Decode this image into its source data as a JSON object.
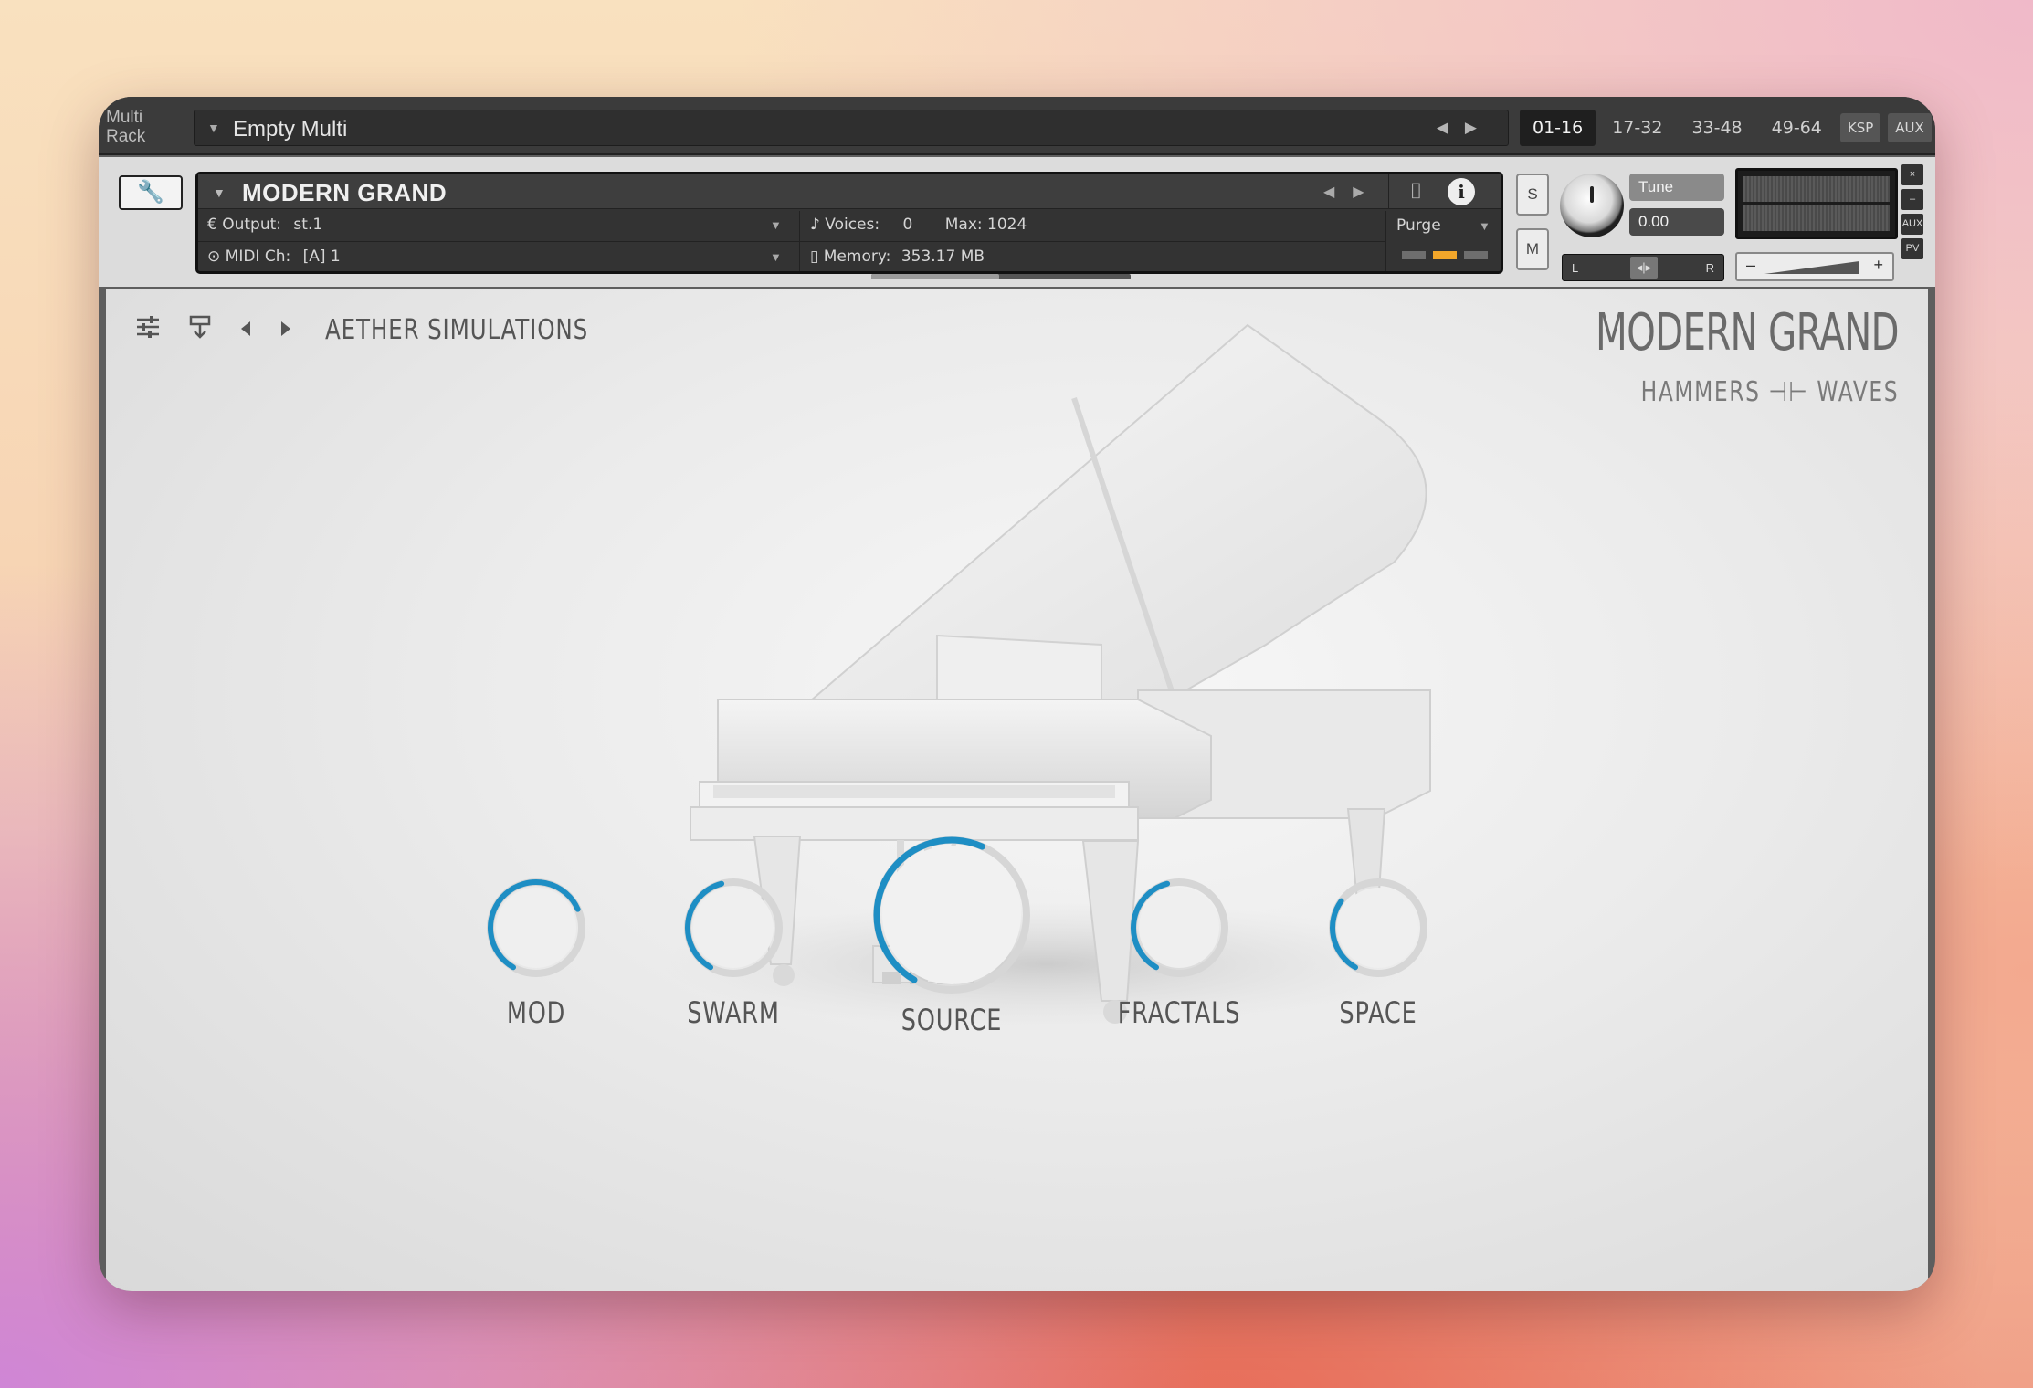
{
  "multi_rack": {
    "label_line1": "Multi",
    "label_line2": "Rack",
    "name": "Empty Multi",
    "tabs": [
      {
        "label": "01-16",
        "active": true
      },
      {
        "label": "17-32",
        "active": false
      },
      {
        "label": "33-48",
        "active": false
      },
      {
        "label": "49-64",
        "active": false
      }
    ],
    "ksp_label": "KSP",
    "aux_label": "AUX"
  },
  "instrument": {
    "title": "MODERN GRAND",
    "output_label": "Output:",
    "output_value": "st.1",
    "midi_label": "MIDI Ch:",
    "midi_value": "[A]  1",
    "voices_label": "Voices:",
    "voices_value": "0",
    "max_label": "Max:",
    "max_value": "1024",
    "memory_label": "Memory:",
    "memory_value": "353.17 MB",
    "purge_label": "Purge",
    "solo_label": "S",
    "mute_label": "M",
    "tune_label": "Tune",
    "tune_value": "0.00",
    "pan_left": "L",
    "pan_right": "R",
    "side_buttons": [
      "×",
      "–",
      "AUX",
      "PV"
    ]
  },
  "panel": {
    "brand": "AETHER SIMULATIONS",
    "logo_title": "MODERN GRAND",
    "logo_subtitle": "HAMMERS ⊣⊢ WAVES",
    "knobs": [
      {
        "label": "MOD",
        "value": 0.72
      },
      {
        "label": "SWARM",
        "value": 0.45
      },
      {
        "label": "SOURCE",
        "value": 0.58
      },
      {
        "label": "FRACTALS",
        "value": 0.45
      },
      {
        "label": "SPACE",
        "value": 0.32
      }
    ]
  },
  "colors": {
    "knob_accent": "#1e8ec4",
    "led_active": "#f2a62a"
  }
}
